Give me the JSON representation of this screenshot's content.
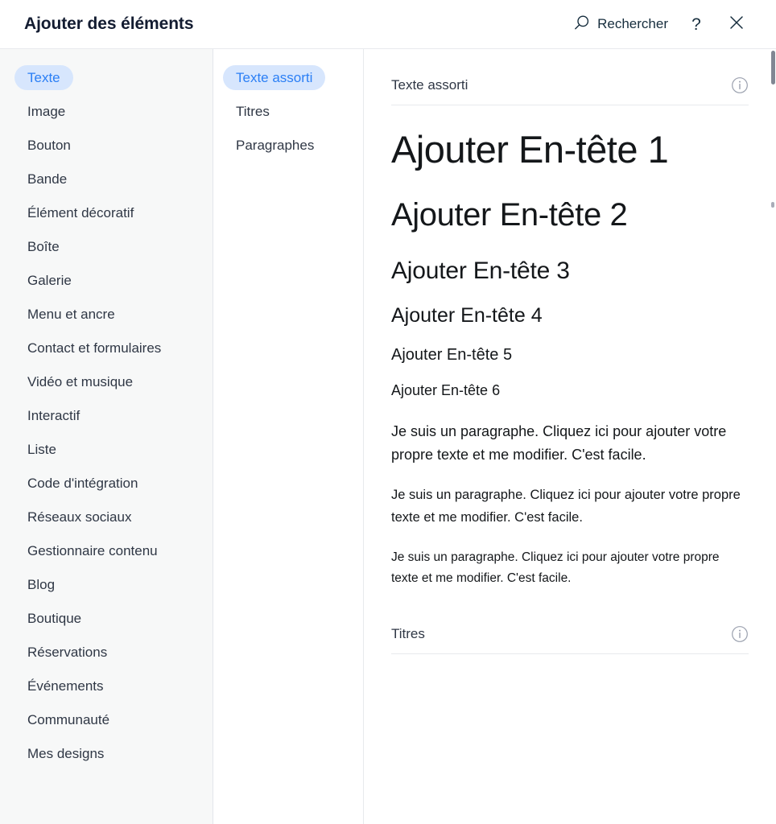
{
  "header": {
    "title": "Ajouter des éléments",
    "search_label": "Rechercher",
    "search_icon": "search-icon",
    "help_label": "?",
    "close_label": "✕"
  },
  "categories": [
    {
      "label": "Texte",
      "active": true
    },
    {
      "label": "Image",
      "active": false
    },
    {
      "label": "Bouton",
      "active": false
    },
    {
      "label": "Bande",
      "active": false
    },
    {
      "label": "Élément décoratif",
      "active": false
    },
    {
      "label": "Boîte",
      "active": false
    },
    {
      "label": "Galerie",
      "active": false
    },
    {
      "label": "Menu et ancre",
      "active": false
    },
    {
      "label": "Contact et formulaires",
      "active": false
    },
    {
      "label": "Vidéo et musique",
      "active": false
    },
    {
      "label": "Interactif",
      "active": false
    },
    {
      "label": "Liste",
      "active": false
    },
    {
      "label": "Code d'intégration",
      "active": false
    },
    {
      "label": "Réseaux sociaux",
      "active": false
    },
    {
      "label": "Gestionnaire contenu",
      "active": false
    },
    {
      "label": "Blog",
      "active": false
    },
    {
      "label": "Boutique",
      "active": false
    },
    {
      "label": "Réservations",
      "active": false
    },
    {
      "label": "Événements",
      "active": false
    },
    {
      "label": "Communauté",
      "active": false
    },
    {
      "label": "Mes designs",
      "active": false
    }
  ],
  "subcategories": [
    {
      "label": "Texte assorti",
      "active": true
    },
    {
      "label": "Titres",
      "active": false
    },
    {
      "label": "Paragraphes",
      "active": false
    }
  ],
  "preview": {
    "section_one_title": "Texte assorti",
    "section_two_title": "Titres",
    "info_icon": "info-icon",
    "headings": [
      "Ajouter En-tête 1",
      "Ajouter En-tête 2",
      "Ajouter En-tête 3",
      "Ajouter En-tête 4",
      "Ajouter En-tête 5",
      "Ajouter En-tête 6"
    ],
    "paragraphs": [
      "Je suis un paragraphe. Cliquez ici pour ajouter votre propre texte et me modifier. C'est facile.",
      "Je suis un paragraphe. Cliquez ici pour ajouter votre propre texte et me modifier. C'est facile.",
      "Je suis un paragraphe. Cliquez ici pour ajouter votre propre texte et me modifier. C'est facile."
    ]
  },
  "colors": {
    "accent_blue": "#2b7ff5",
    "accent_pill_bg": "#d7e6fd",
    "sidebar_bg": "#f7f8f8",
    "title_navy": "#131c31",
    "text_dark": "#2f3745",
    "divider": "#e8eaed"
  }
}
